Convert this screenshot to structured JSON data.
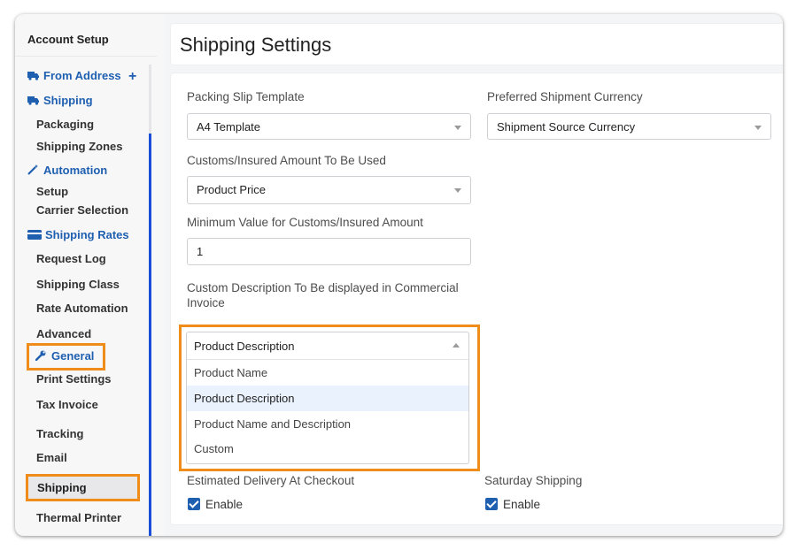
{
  "sidebar": {
    "title": "Account Setup",
    "items": [
      {
        "label": "From Address",
        "type": "section",
        "icon": "truck-icon"
      },
      {
        "label": "Shipping",
        "type": "section",
        "icon": "truck-icon"
      },
      {
        "label": "Packaging",
        "type": "sub"
      },
      {
        "label": "Shipping Zones",
        "type": "sub"
      },
      {
        "label": "Automation",
        "type": "section",
        "icon": "magic-wand-icon"
      },
      {
        "label": "Setup",
        "type": "sub"
      },
      {
        "label": "Carrier Selection",
        "type": "sub"
      },
      {
        "label": "Shipping Rates",
        "type": "section",
        "icon": "credit-card-icon"
      },
      {
        "label": "Request Log",
        "type": "sub"
      },
      {
        "label": "Shipping Class",
        "type": "sub"
      },
      {
        "label": "Rate Automation",
        "type": "sub"
      },
      {
        "label": "Advanced",
        "type": "sub"
      },
      {
        "label": "General",
        "type": "section",
        "icon": "wrench-icon"
      },
      {
        "label": "Print Settings",
        "type": "sub"
      },
      {
        "label": "Tax Invoice",
        "type": "sub"
      },
      {
        "label": "Tracking",
        "type": "sub"
      },
      {
        "label": "Email",
        "type": "sub"
      },
      {
        "label": "Shipping",
        "type": "sub",
        "active": true
      },
      {
        "label": "Thermal Printer",
        "type": "sub"
      }
    ],
    "add_icon": "plus-icon"
  },
  "header": {
    "title": "Shipping Settings"
  },
  "form": {
    "packing_slip": {
      "label": "Packing Slip Template",
      "value": "A4 Template"
    },
    "currency": {
      "label": "Preferred Shipment Currency",
      "value": "Shipment Source Currency"
    },
    "customs_amount": {
      "label": "Customs/Insured Amount To Be Used",
      "value": "Product Price"
    },
    "min_value": {
      "label": "Minimum Value for Customs/Insured Amount",
      "value": "1"
    },
    "custom_desc": {
      "label": "Custom Description To Be displayed in Commercial Invoice",
      "value": "Product Description",
      "options": [
        "Product Name",
        "Product Description",
        "Product Name and Description",
        "Custom"
      ],
      "selected_index": 1
    },
    "estimated_delivery": {
      "label": "Estimated Delivery At Checkout",
      "checkbox_label": "Enable",
      "checked": true
    },
    "saturday_shipping": {
      "label": "Saturday Shipping",
      "checkbox_label": "Enable",
      "checked": true
    }
  },
  "colors": {
    "accent": "#1f5fb0",
    "highlight": "#f08c1a",
    "scroll_thumb": "#1a4ed8"
  }
}
